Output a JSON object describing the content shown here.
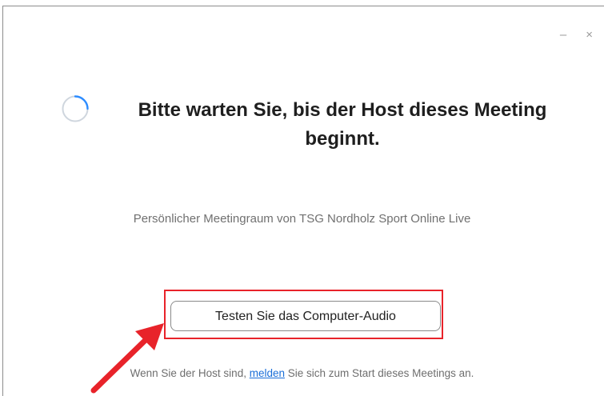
{
  "window": {
    "minimize_label": "–",
    "close_label": "×"
  },
  "main": {
    "headline": "Bitte warten Sie, bis der Host dieses Meeting beginnt.",
    "subtitle": "Persönlicher Meetingraum von TSG Nordholz Sport Online Live",
    "audio_button_label": "Testen Sie das Computer-Audio"
  },
  "footer": {
    "prefix": "Wenn Sie der Host sind,",
    "link": "melden",
    "suffix": "Sie sich zum Start dieses Meetings an."
  },
  "icons": {
    "spinner": "loading-spinner-icon",
    "annotation_arrow": "arrow-icon"
  },
  "colors": {
    "accent_blue": "#1a6ed8",
    "annotation_red": "#e8232a",
    "spinner_blue": "#2d8cff"
  }
}
